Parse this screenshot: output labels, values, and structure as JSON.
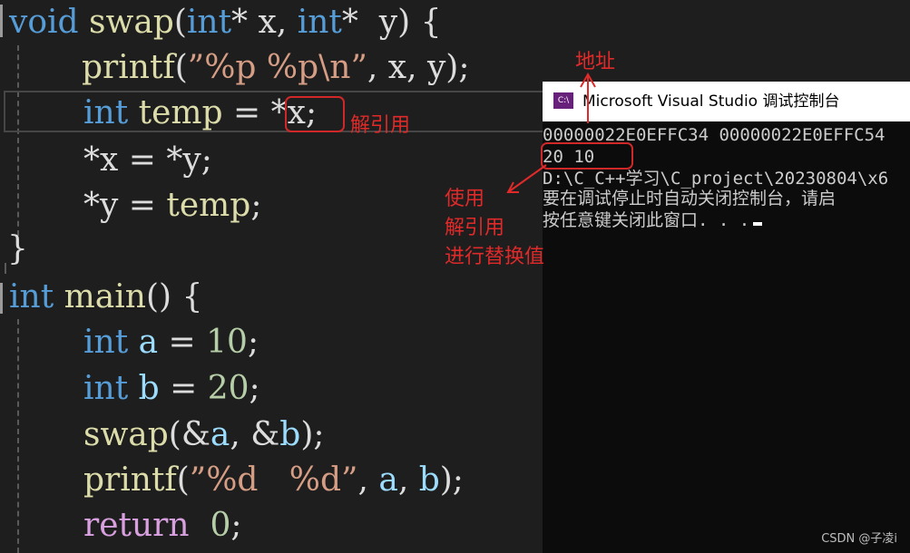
{
  "code": {
    "l1": {
      "void": "void",
      "fn": "swap",
      "p1": "(",
      "int1": "int",
      "star1": "* x, ",
      "int2": "int",
      "star2": "*  y) {"
    },
    "l2": {
      "fn": "printf",
      "a": "(",
      "str": "”%p %p\\n”",
      "b": ", x, y);"
    },
    "l3": {
      "type": "int",
      "var": "temp",
      "op": " = ",
      "deref": "*x;"
    },
    "l4": {
      "text": "*x = *y;"
    },
    "l5": {
      "a": "*y = ",
      "var": "temp",
      "b": ";"
    },
    "l6": {
      "text": "}"
    },
    "l7": {
      "type": "int",
      "fn": "main",
      "rest": "() {"
    },
    "l8": {
      "type": "int",
      "var": "a",
      "op": " = ",
      "num": "10",
      "end": ";"
    },
    "l9": {
      "type": "int",
      "var": "b",
      "op": " = ",
      "num": "20",
      "end": ";"
    },
    "l10": {
      "fn": "swap",
      "a": "(&",
      "v1": "a",
      "b": ", &",
      "v2": "b",
      "c": ");"
    },
    "l11": {
      "fn": "printf",
      "a": "(",
      "str": "”%d   %d”",
      "b": ", ",
      "v1": "a",
      "c": ", ",
      "v2": "b",
      "d": ");"
    },
    "l12": {
      "ret": "return",
      "num": "0",
      "end": ";"
    }
  },
  "console": {
    "icon_text": "C:\\",
    "title": "Microsoft Visual Studio 调试控制台",
    "lines": [
      "00000022E0EFFC34 00000022E0EFFC54",
      "20   10",
      "D:\\C_C++学习\\C_project\\20230804\\x6",
      "要在调试停止时自动关闭控制台，请启",
      "按任意键关闭此窗口. . ."
    ]
  },
  "annotations": {
    "address": "地址",
    "deref": "解引用",
    "note_line1": "使用",
    "note_line2": "解引用",
    "note_line3": "进行替换值"
  },
  "colors": {
    "editor_bg": "#1e1e1e",
    "keyword": "#569cd6",
    "function": "#dcdcaa",
    "number": "#b5cea8",
    "string": "#d69d85",
    "annotation_red": "#e02a2a"
  },
  "watermark": "CSDN @子凌i"
}
